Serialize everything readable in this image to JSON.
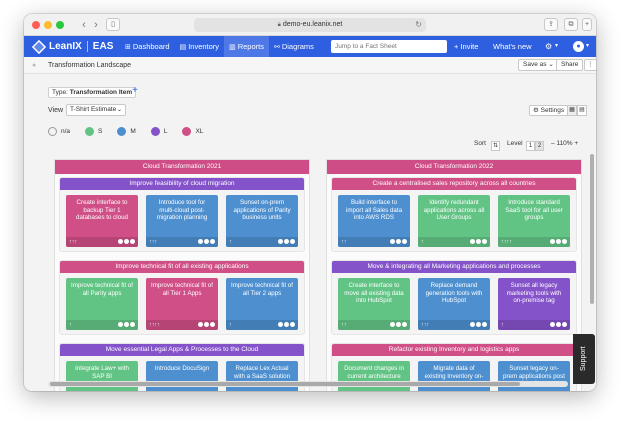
{
  "browser": {
    "url": "demo-eu.leanix.net",
    "lock_icon": "lock-icon",
    "reload_icon": "reload-icon"
  },
  "app": {
    "logo_text": "LeanIX",
    "workspace": "EAS",
    "nav": [
      {
        "label": "Dashboard",
        "icon": "⊞"
      },
      {
        "label": "Inventory",
        "icon": "▤"
      },
      {
        "label": "Reports",
        "icon": "▥"
      },
      {
        "label": "Diagrams",
        "icon": "⚯"
      }
    ],
    "search_placeholder": "Jump to a Fact Sheet",
    "invite": "+ Invite",
    "whats_new": "What's new",
    "brand_color": "#2d5fe0"
  },
  "subheader": {
    "title": "Transformation Landscape",
    "save_as": "Save as",
    "share": "Share"
  },
  "toolbar": {
    "type_label": "Type:",
    "type_value": "Transformation Item",
    "view_label": "View",
    "view_value": "T-Shirt Estimate",
    "settings": "Settings",
    "sort_label": "Sort",
    "level_label": "Level",
    "level_1": "1",
    "level_2": "2",
    "zoom": "110%",
    "zoom_minus": "–",
    "zoom_plus": "+"
  },
  "legend": [
    {
      "label": "n/a",
      "color": "#ffffff"
    },
    {
      "label": "S",
      "color": "#62c484"
    },
    {
      "label": "M",
      "color": "#4d8fcf"
    },
    {
      "label": "L",
      "color": "#8452c9"
    },
    {
      "label": "XL",
      "color": "#d04f86"
    }
  ],
  "columns": [
    {
      "title": "Cloud Transformation 2021",
      "groups": [
        {
          "title": "Improve feasibility of cloud migration",
          "color": "#8452c9",
          "cards": [
            {
              "text": "Create interface to backup Tier 1 databases to cloud",
              "color": "#d04f86",
              "arrows": "↑↑↑"
            },
            {
              "text": "Introduce tool for multi-cloud post-migration planning",
              "color": "#4d8fcf",
              "arrows": "↑↑↑"
            },
            {
              "text": "Sunset on-prem applications of Parity business units",
              "color": "#4d8fcf",
              "arrows": "↑"
            }
          ]
        },
        {
          "title": "Improve technical fit of all existing applications",
          "color": "#d04f86",
          "cards": [
            {
              "text": "Improve technical fit of all Parity apps",
              "color": "#62c484",
              "arrows": "↑"
            },
            {
              "text": "Improve technical fit of all Tier 1 Apps",
              "color": "#d04f86",
              "arrows": "↑↑↑↑"
            },
            {
              "text": "Improve technical fit of all Tier 2 apps",
              "color": "#4d8fcf",
              "arrows": "↑"
            }
          ]
        },
        {
          "title": "Move essential Legal Apps & Processes to the Cloud",
          "color": "#8452c9",
          "cards": [
            {
              "text": "Integrate Law+ with SAP BI",
              "color": "#62c484",
              "arrows": ""
            },
            {
              "text": "Introduce DocuSign",
              "color": "#4d8fcf",
              "arrows": ""
            },
            {
              "text": "Replace Lex Actual with a SaaS solution",
              "color": "#4d8fcf",
              "arrows": ""
            }
          ]
        }
      ]
    },
    {
      "title": "Cloud Transformation 2022",
      "groups": [
        {
          "title": "Create a centralised sales repository across all countries",
          "color": "#d04f86",
          "cards": [
            {
              "text": "Build interface to import all Sales data into AWS RDS",
              "color": "#4d8fcf",
              "arrows": "↑↑"
            },
            {
              "text": "Identify redundant applications across all User Groups",
              "color": "#62c484",
              "arrows": "↑"
            },
            {
              "text": "Introduce standard SaaS tool for all user groups",
              "color": "#62c484",
              "arrows": "↑↑↑↑"
            }
          ]
        },
        {
          "title": "Move & integrating all Marketing applications and processes",
          "color": "#8452c9",
          "cards": [
            {
              "text": "Create interface to move all existing data into HubSpot",
              "color": "#62c484",
              "arrows": "↑↑"
            },
            {
              "text": "Replace demand generation tools with HubSpot",
              "color": "#4d8fcf",
              "arrows": "↑↑↑"
            },
            {
              "text": "Sunset all legacy marketing tools with on-premise tag",
              "color": "#8452c9",
              "arrows": "↑"
            }
          ]
        },
        {
          "title": "Refactor existing Inventory and logistics apps",
          "color": "#d04f86",
          "cards": [
            {
              "text": "Document changes in current architecture",
              "color": "#62c484",
              "arrows": ""
            },
            {
              "text": "Migrate data of existing Inventory on-prem",
              "color": "#4d8fcf",
              "arrows": ""
            },
            {
              "text": "Sunset legacy on-prem applications post data dump",
              "color": "#4d8fcf",
              "arrows": ""
            }
          ]
        }
      ]
    }
  ],
  "support": "Support"
}
